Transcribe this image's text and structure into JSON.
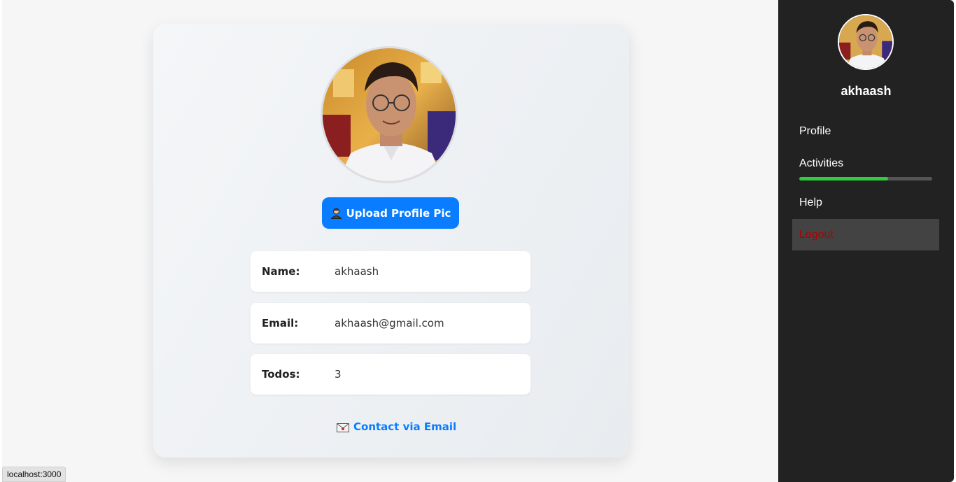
{
  "profile_card": {
    "upload_button_label": "Upload Profile Pic",
    "fields": [
      {
        "label": "Name:",
        "value": "akhaash"
      },
      {
        "label": "Email:",
        "value": "akhaash@gmail.com"
      },
      {
        "label": "Todos:",
        "value": "3"
      }
    ],
    "contact_link_label": "Contact via Email"
  },
  "sidebar": {
    "username": "akhaash",
    "nav": {
      "profile": "Profile",
      "activities": "Activities",
      "help": "Help",
      "logout": "Logout"
    },
    "activities_progress": 0.67
  },
  "status_bar": {
    "url": "localhost:3000"
  },
  "colors": {
    "primary": "#0a7cff",
    "sidebar_bg": "#222222",
    "progress": "#2ecc40",
    "logout_text": "#b00000"
  },
  "icons": {
    "upload": "person-icon",
    "contact": "envelope-icon"
  }
}
